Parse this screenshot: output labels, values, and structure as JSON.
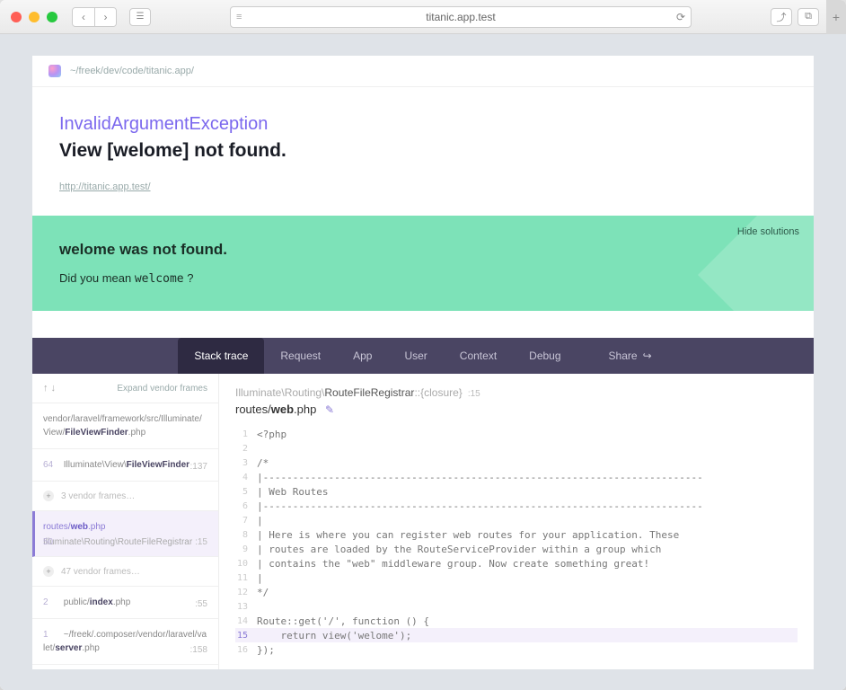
{
  "browser": {
    "url": "titanic.app.test"
  },
  "breadcrumb_path": "~/freek/dev/code/titanic.app/",
  "exception": {
    "type": "InvalidArgumentException",
    "message": "View [welome] not found.",
    "url": "http://titanic.app.test/"
  },
  "solution": {
    "hide_label": "Hide solutions",
    "title": "welome was not found.",
    "hint_prefix": "Did you mean ",
    "suggestion": "welcome",
    "hint_suffix": " ?"
  },
  "tabs": {
    "stack": "Stack trace",
    "request": "Request",
    "app": "App",
    "user": "User",
    "context": "Context",
    "debug": "Debug",
    "share": "Share"
  },
  "frames": {
    "expand_label": "Expand vendor frames",
    "items": [
      {
        "path_pre": "vendor/laravel/framework/src/Illuminate/View/",
        "path_bold": "FileViewFinder",
        "path_post": ".php",
        "line": ""
      },
      {
        "num": "64",
        "path_pre": "Illuminate\\View\\",
        "path_bold": "FileViewFinder",
        "path_post": "",
        "line": ":137"
      },
      {
        "collapsed": true,
        "label": "3 vendor frames…"
      },
      {
        "active": true,
        "num": "50",
        "path_pre": "routes/",
        "path_bold": "web",
        "path_post": ".php",
        "sub": "Illuminate\\Routing\\RouteFileRegistrar",
        "line": ":15"
      },
      {
        "collapsed": true,
        "label": "47 vendor frames…"
      },
      {
        "num": "2",
        "path_pre": "public/",
        "path_bold": "index",
        "path_post": ".php",
        "line": ":55"
      },
      {
        "num": "1",
        "path_pre": "~/freek/.composer/vendor/laravel/valet/",
        "path_bold": "server",
        "path_post": ".php",
        "line": ":158"
      }
    ]
  },
  "code": {
    "crumb_dim": "Illuminate\\Routing\\",
    "crumb_strong": "RouteFileRegistrar",
    "crumb_method": "::{closure}",
    "crumb_line": ":15",
    "file_pre": "routes/",
    "file_bold": "web",
    "file_post": ".php",
    "lines": [
      {
        "n": 1,
        "t": "<?php"
      },
      {
        "n": 2,
        "t": ""
      },
      {
        "n": 3,
        "t": "/*"
      },
      {
        "n": 4,
        "t": "|--------------------------------------------------------------------------"
      },
      {
        "n": 5,
        "t": "| Web Routes"
      },
      {
        "n": 6,
        "t": "|--------------------------------------------------------------------------"
      },
      {
        "n": 7,
        "t": "|"
      },
      {
        "n": 8,
        "t": "| Here is where you can register web routes for your application. These"
      },
      {
        "n": 9,
        "t": "| routes are loaded by the RouteServiceProvider within a group which"
      },
      {
        "n": 10,
        "t": "| contains the \"web\" middleware group. Now create something great!"
      },
      {
        "n": 11,
        "t": "|"
      },
      {
        "n": 12,
        "t": "*/"
      },
      {
        "n": 13,
        "t": ""
      },
      {
        "n": 14,
        "t": "Route::get('/', function () {"
      },
      {
        "n": 15,
        "t": "    return view('welome');",
        "hl": true
      },
      {
        "n": 16,
        "t": "});"
      }
    ]
  }
}
